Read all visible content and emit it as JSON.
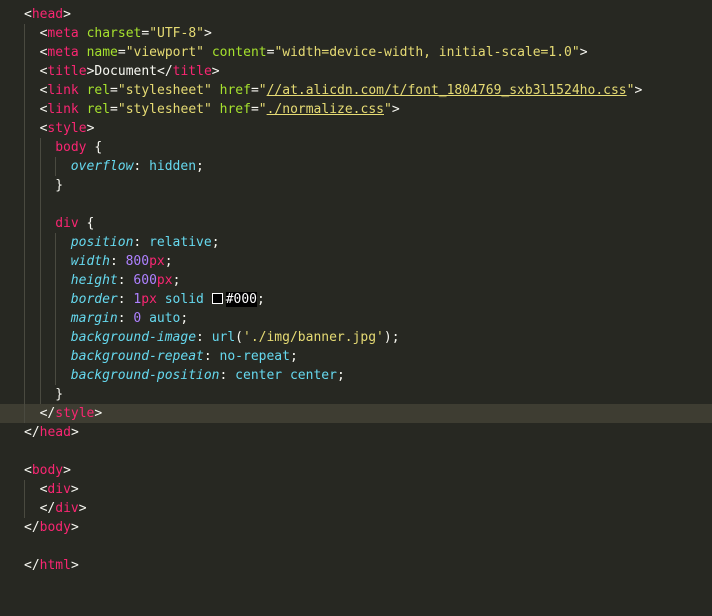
{
  "editor": {
    "theme": "monokai",
    "colors": {
      "background": "#272822",
      "tag": "#f92672",
      "attribute": "#a6e22e",
      "string": "#e6db74",
      "property": "#66d9ef",
      "number": "#ae81ff",
      "punctuation": "#f8f8f2"
    },
    "lines": [
      {
        "indent": 0,
        "tokens": [
          [
            "p",
            "<"
          ],
          [
            "t",
            "head"
          ],
          [
            "p",
            ">"
          ]
        ]
      },
      {
        "indent": 1,
        "tokens": [
          [
            "p",
            "<"
          ],
          [
            "t",
            "meta"
          ],
          [
            "p",
            " "
          ],
          [
            "a",
            "charset"
          ],
          [
            "p",
            "="
          ],
          [
            "s",
            "\"UTF-8\""
          ],
          [
            "p",
            ">"
          ]
        ]
      },
      {
        "indent": 1,
        "tokens": [
          [
            "p",
            "<"
          ],
          [
            "t",
            "meta"
          ],
          [
            "p",
            " "
          ],
          [
            "a",
            "name"
          ],
          [
            "p",
            "="
          ],
          [
            "s",
            "\"viewport\""
          ],
          [
            "p",
            " "
          ],
          [
            "a",
            "content"
          ],
          [
            "p",
            "="
          ],
          [
            "s",
            "\"width=device-width, initial-scale=1.0\""
          ],
          [
            "p",
            ">"
          ]
        ]
      },
      {
        "indent": 1,
        "tokens": [
          [
            "p",
            "<"
          ],
          [
            "t",
            "title"
          ],
          [
            "p",
            ">Document</"
          ],
          [
            "t",
            "title"
          ],
          [
            "p",
            ">"
          ]
        ]
      },
      {
        "indent": 1,
        "tokens": [
          [
            "p",
            "<"
          ],
          [
            "t",
            "link"
          ],
          [
            "p",
            " "
          ],
          [
            "a",
            "rel"
          ],
          [
            "p",
            "="
          ],
          [
            "s",
            "\"stylesheet\""
          ],
          [
            "p",
            " "
          ],
          [
            "a",
            "href"
          ],
          [
            "p",
            "="
          ],
          [
            "s",
            "\""
          ],
          [
            "su",
            "//at.alicdn.com/t/font_1804769_sxb3l1524ho.css"
          ],
          [
            "s",
            "\""
          ],
          [
            "p",
            ">"
          ]
        ]
      },
      {
        "indent": 1,
        "tokens": [
          [
            "p",
            "<"
          ],
          [
            "t",
            "link"
          ],
          [
            "p",
            " "
          ],
          [
            "a",
            "rel"
          ],
          [
            "p",
            "="
          ],
          [
            "s",
            "\"stylesheet\""
          ],
          [
            "p",
            " "
          ],
          [
            "a",
            "href"
          ],
          [
            "p",
            "="
          ],
          [
            "s",
            "\""
          ],
          [
            "su",
            "./normalize.css"
          ],
          [
            "s",
            "\""
          ],
          [
            "p",
            ">"
          ]
        ]
      },
      {
        "indent": 1,
        "tokens": [
          [
            "p",
            "<"
          ],
          [
            "t",
            "style"
          ],
          [
            "p",
            ">"
          ]
        ]
      },
      {
        "indent": 2,
        "tokens": [
          [
            "t",
            "body"
          ],
          [
            "p",
            " {"
          ]
        ]
      },
      {
        "indent": 3,
        "tokens": [
          [
            "prop",
            "overflow"
          ],
          [
            "p",
            ": "
          ],
          [
            "v",
            "hidden"
          ],
          [
            "p",
            ";"
          ]
        ]
      },
      {
        "indent": 2,
        "tokens": [
          [
            "p",
            "}"
          ]
        ]
      },
      {
        "indent": 0,
        "tokens": []
      },
      {
        "indent": 2,
        "tokens": [
          [
            "t",
            "div"
          ],
          [
            "p",
            " {"
          ]
        ]
      },
      {
        "indent": 3,
        "tokens": [
          [
            "prop",
            "position"
          ],
          [
            "p",
            ": "
          ],
          [
            "v",
            "relative"
          ],
          [
            "p",
            ";"
          ]
        ]
      },
      {
        "indent": 3,
        "tokens": [
          [
            "prop",
            "width"
          ],
          [
            "p",
            ": "
          ],
          [
            "n",
            "800"
          ],
          [
            "u",
            "px"
          ],
          [
            "p",
            ";"
          ]
        ]
      },
      {
        "indent": 3,
        "tokens": [
          [
            "prop",
            "height"
          ],
          [
            "p",
            ": "
          ],
          [
            "n",
            "600"
          ],
          [
            "u",
            "px"
          ],
          [
            "p",
            ";"
          ]
        ]
      },
      {
        "indent": 3,
        "tokens": [
          [
            "prop",
            "border"
          ],
          [
            "p",
            ": "
          ],
          [
            "n",
            "1"
          ],
          [
            "u",
            "px"
          ],
          [
            "p",
            " "
          ],
          [
            "v",
            "solid"
          ],
          [
            "p",
            " "
          ],
          [
            "sw",
            ""
          ],
          [
            "cb",
            "#000"
          ],
          [
            "p",
            ";"
          ]
        ]
      },
      {
        "indent": 3,
        "tokens": [
          [
            "prop",
            "margin"
          ],
          [
            "p",
            ": "
          ],
          [
            "n",
            "0"
          ],
          [
            "p",
            " "
          ],
          [
            "v",
            "auto"
          ],
          [
            "p",
            ";"
          ]
        ]
      },
      {
        "indent": 3,
        "tokens": [
          [
            "prop",
            "background-image"
          ],
          [
            "p",
            ": "
          ],
          [
            "v",
            "url"
          ],
          [
            "p",
            "("
          ],
          [
            "s",
            "'./img/banner.jpg'"
          ],
          [
            "p",
            ");"
          ]
        ]
      },
      {
        "indent": 3,
        "tokens": [
          [
            "prop",
            "background-repeat"
          ],
          [
            "p",
            ": "
          ],
          [
            "v",
            "no-repeat"
          ],
          [
            "p",
            ";"
          ]
        ]
      },
      {
        "indent": 3,
        "tokens": [
          [
            "prop",
            "background-position"
          ],
          [
            "p",
            ": "
          ],
          [
            "v",
            "center"
          ],
          [
            "p",
            " "
          ],
          [
            "v",
            "center"
          ],
          [
            "p",
            ";"
          ]
        ]
      },
      {
        "indent": 2,
        "tokens": [
          [
            "p",
            "}"
          ]
        ]
      },
      {
        "indent": 1,
        "tokens": [
          [
            "p",
            "</"
          ],
          [
            "t",
            "style"
          ],
          [
            "p",
            ">"
          ]
        ],
        "highlight": true
      },
      {
        "indent": 0,
        "tokens": [
          [
            "p",
            "</"
          ],
          [
            "t",
            "head"
          ],
          [
            "p",
            ">"
          ]
        ]
      },
      {
        "indent": 0,
        "tokens": []
      },
      {
        "indent": 0,
        "tokens": [
          [
            "p",
            "<"
          ],
          [
            "t",
            "body"
          ],
          [
            "p",
            ">"
          ]
        ]
      },
      {
        "indent": 1,
        "tokens": [
          [
            "p",
            "<"
          ],
          [
            "t",
            "div"
          ],
          [
            "p",
            ">"
          ]
        ]
      },
      {
        "indent": 1,
        "tokens": [
          [
            "p",
            "</"
          ],
          [
            "t",
            "div"
          ],
          [
            "p",
            ">"
          ]
        ]
      },
      {
        "indent": 0,
        "tokens": [
          [
            "p",
            "</"
          ],
          [
            "t",
            "body"
          ],
          [
            "p",
            ">"
          ]
        ]
      },
      {
        "indent": 0,
        "tokens": []
      },
      {
        "indent": 0,
        "tokens": [
          [
            "p",
            "</"
          ],
          [
            "t",
            "html"
          ],
          [
            "p",
            ">"
          ]
        ]
      }
    ]
  }
}
